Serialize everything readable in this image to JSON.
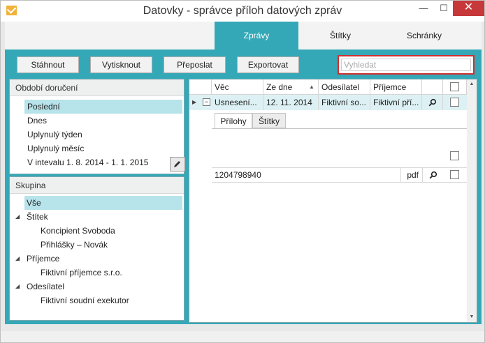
{
  "window": {
    "title": "Datovky - správce příloh datových zpráv",
    "minimize": "—",
    "maximize": "☐",
    "close": "✕"
  },
  "tabs": [
    {
      "label": "Zprávy",
      "active": true
    },
    {
      "label": "Štítky",
      "active": false
    },
    {
      "label": "Schránky",
      "active": false
    }
  ],
  "toolbar": {
    "download_label": "Stáhnout",
    "print_label": "Vytisknout",
    "forward_label": "Přeposlat",
    "export_label": "Exportovat"
  },
  "search": {
    "placeholder": "Vyhledat",
    "value": ""
  },
  "period": {
    "header": "Období doručení",
    "items": [
      "Poslední",
      "Dnes",
      "Uplynulý týden",
      "Uplynulý měsíc",
      "V intevalu 1. 8. 2014 - 1. 1. 2015"
    ],
    "selected_index": 0
  },
  "group": {
    "header": "Skupina",
    "items": [
      {
        "label": "Vše",
        "level": 0,
        "expander": false
      },
      {
        "label": "Štítek",
        "level": 0,
        "expander": true
      },
      {
        "label": "Koncipient Svoboda",
        "level": 1,
        "expander": false
      },
      {
        "label": "Přihlášky – Novák",
        "level": 1,
        "expander": false
      },
      {
        "label": "Příjemce",
        "level": 0,
        "expander": true
      },
      {
        "label": "Fiktivní příjemce s.r.o.",
        "level": 1,
        "expander": false
      },
      {
        "label": "Odesílatel",
        "level": 0,
        "expander": true
      },
      {
        "label": "Fiktivní soudní exekutor",
        "level": 1,
        "expander": false
      }
    ]
  },
  "grid": {
    "columns": [
      "Věc",
      "Ze dne",
      "Odesílatel",
      "Příjemce"
    ],
    "sorted_column": "Ze dne",
    "rows": [
      {
        "subject": "Usnesení...",
        "date": "12. 11. 2014",
        "sender": "Fiktivní so...",
        "recipient": "Fiktivní pří..."
      }
    ],
    "sub_tabs": [
      "Přílohy",
      "Štítky"
    ],
    "attachments": [
      {
        "name": "1204798940",
        "type": "pdf"
      }
    ]
  },
  "icons": {
    "edit": "pencil-icon",
    "search": "magnifier-icon",
    "expand": "triangle-right-icon",
    "collapse": "minus-box-icon"
  },
  "colors": {
    "accent": "#35a8b7",
    "selection": "#b7e3ea",
    "search_border": "#d03030",
    "close": "#c7383a"
  }
}
